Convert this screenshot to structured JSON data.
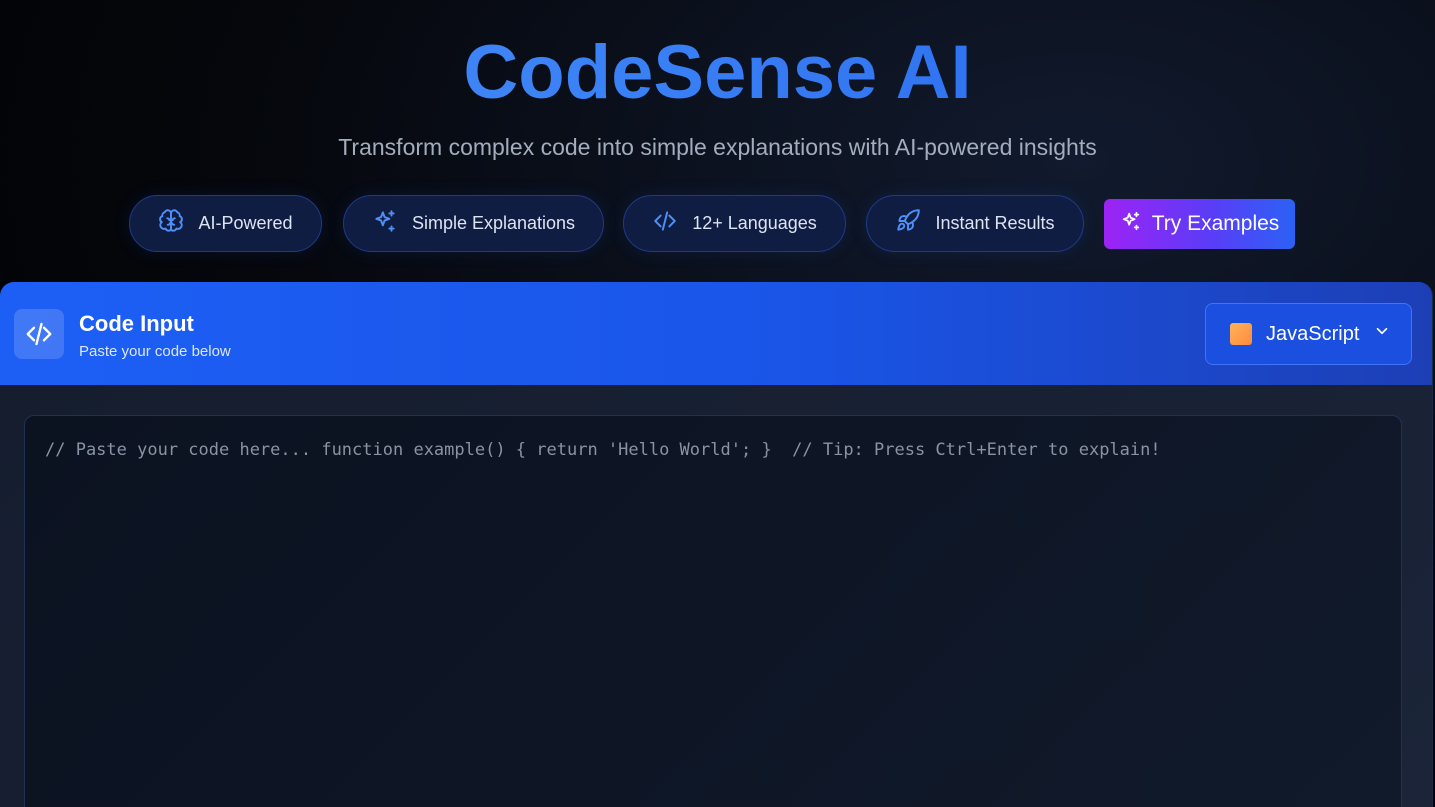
{
  "hero": {
    "title": "CodeSense AI",
    "subtitle": "Transform complex code into simple explanations with AI-powered insights"
  },
  "features": [
    {
      "label": "AI-Powered",
      "icon": "brain-icon"
    },
    {
      "label": "Simple Explanations",
      "icon": "sparkles-icon"
    },
    {
      "label": "12+ Languages",
      "icon": "code-icon"
    },
    {
      "label": "Instant Results",
      "icon": "rocket-icon"
    }
  ],
  "try_button": {
    "label": "Try Examples",
    "icon": "sparkles-icon"
  },
  "panel": {
    "title": "Code Input",
    "subtitle": "Paste your code below",
    "icon": "code-icon",
    "language": {
      "selected": "JavaScript",
      "icon": "chevron-down-icon"
    },
    "editor": {
      "value": "",
      "placeholder": "// Paste your code here... function example() { return 'Hello World'; }  // Tip: Press Ctrl+Enter to explain!"
    }
  },
  "colors": {
    "accent_blue": "#2563eb",
    "title_gradient_start": "#4f8ff7",
    "button_gradient_start": "#9d23f5",
    "button_gradient_end": "#2b62f5",
    "javascript_badge": "#ff9f4a"
  }
}
